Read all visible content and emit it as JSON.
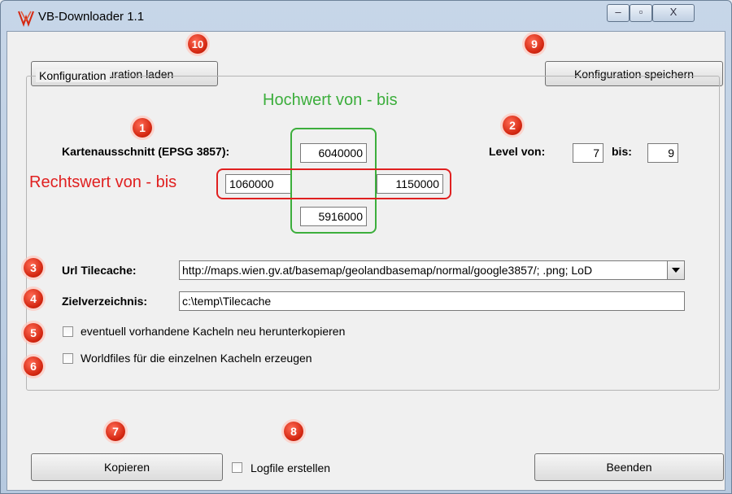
{
  "window": {
    "title": "VB-Downloader 1.1",
    "controls": {
      "minimize": "‒",
      "maximize": "▫",
      "close": "X"
    }
  },
  "toolbar": {
    "load_config": "Konfiguration laden",
    "save_config": "Konfiguration speichern"
  },
  "config": {
    "group_label": "Konfiguration",
    "extent_label": "Kartenausschnitt (EPSG 3857):",
    "north": "6040000",
    "south": "5916000",
    "west": "1060000",
    "east": "1150000",
    "level_from_label": "Level von:",
    "level_from": "7",
    "level_to_label": "bis:",
    "level_to": "9",
    "url_label": "Url Tilecache:",
    "url_value": "http://maps.wien.gv.at/basemap/geolandbasemap/normal/google3857/; .png; LoD",
    "target_label": "Zielverzeichnis:",
    "target_value": "c:\\temp\\Tilecache",
    "overwrite_label": "eventuell vorhandene Kacheln neu herunterkopieren",
    "worldfiles_label": "Worldfiles für die einzelnen Kacheln erzeugen"
  },
  "bottom": {
    "copy": "Kopieren",
    "logfile_label": "Logfile erstellen",
    "exit": "Beenden"
  },
  "annotations": {
    "northing": "Hochwert von - bis",
    "easting": "Rechtswert von - bis",
    "markers": [
      "1",
      "2",
      "3",
      "4",
      "5",
      "6",
      "7",
      "8",
      "9",
      "10"
    ]
  },
  "colors": {
    "marker_red": "#d42711",
    "annotation_green": "#3cae3c",
    "annotation_red": "#e02020"
  }
}
